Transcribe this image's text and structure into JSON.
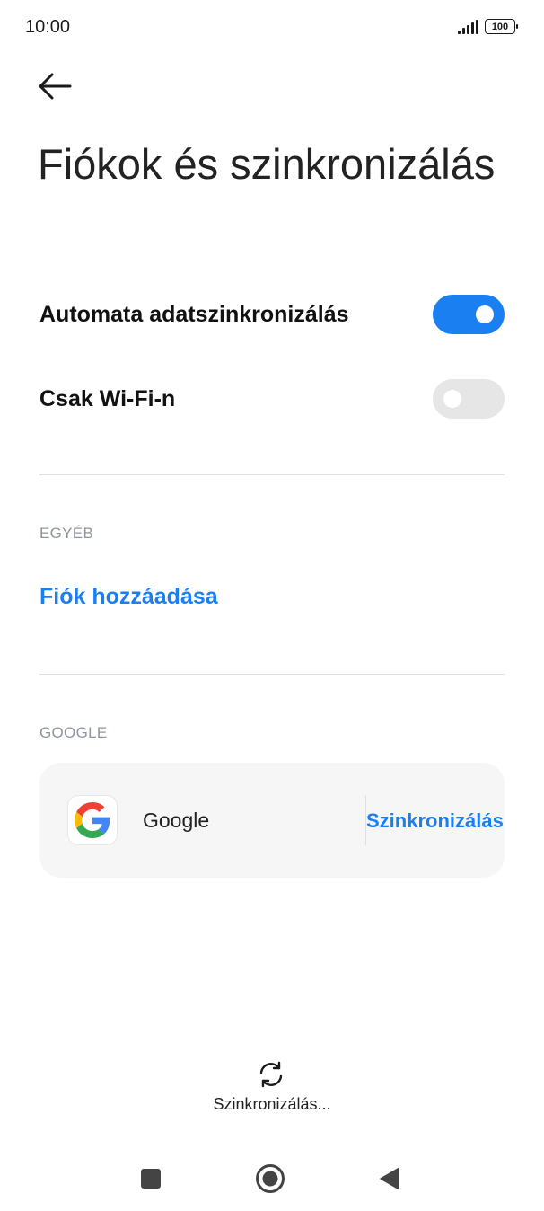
{
  "status_bar": {
    "time": "10:00",
    "battery": "100"
  },
  "header": {
    "back_icon": "arrow-left-icon",
    "title": "Fiókok és szinkronizálás"
  },
  "settings": [
    {
      "label": "Automata adatszinkronizálás",
      "enabled": true
    },
    {
      "label": "Csak Wi-Fi-n",
      "enabled": false
    }
  ],
  "other_section": {
    "header": "EGYÉB",
    "add_account": "Fiók hozzáadása"
  },
  "google_section": {
    "header": "GOOGLE",
    "account_name": "Google",
    "sync_action": "Szinkronizálás"
  },
  "sync_status": {
    "icon": "sync-icon",
    "label": "Szinkronizálás..."
  },
  "nav_bar": {
    "icons": [
      "recents-square-icon",
      "home-circle-icon",
      "back-triangle-icon"
    ]
  },
  "colors": {
    "accent": "#1a7ff0",
    "toggle_off": "#e6e6e6",
    "section_header": "#8f959e",
    "card_background": "#f6f6f6"
  }
}
